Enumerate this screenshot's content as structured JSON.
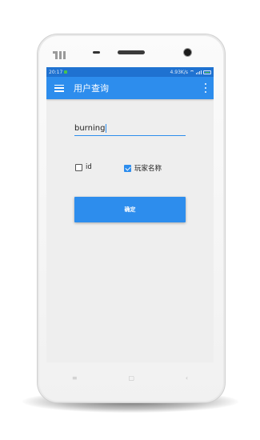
{
  "status": {
    "time": "20:17",
    "network_speed": "4.93K/s"
  },
  "appbar": {
    "title": "用户查询"
  },
  "search": {
    "value": "burning"
  },
  "options": [
    {
      "label": "id",
      "checked": false
    },
    {
      "label": "玩家名称",
      "checked": true
    }
  ],
  "confirm_label": "确定",
  "navkeys": {
    "menu_glyph": "≡",
    "home_glyph": "▢",
    "back_glyph": "‹"
  },
  "colors": {
    "accent": "#2d8ded",
    "statusbar": "#1f72d1",
    "screen_bg": "#eeeeee"
  }
}
